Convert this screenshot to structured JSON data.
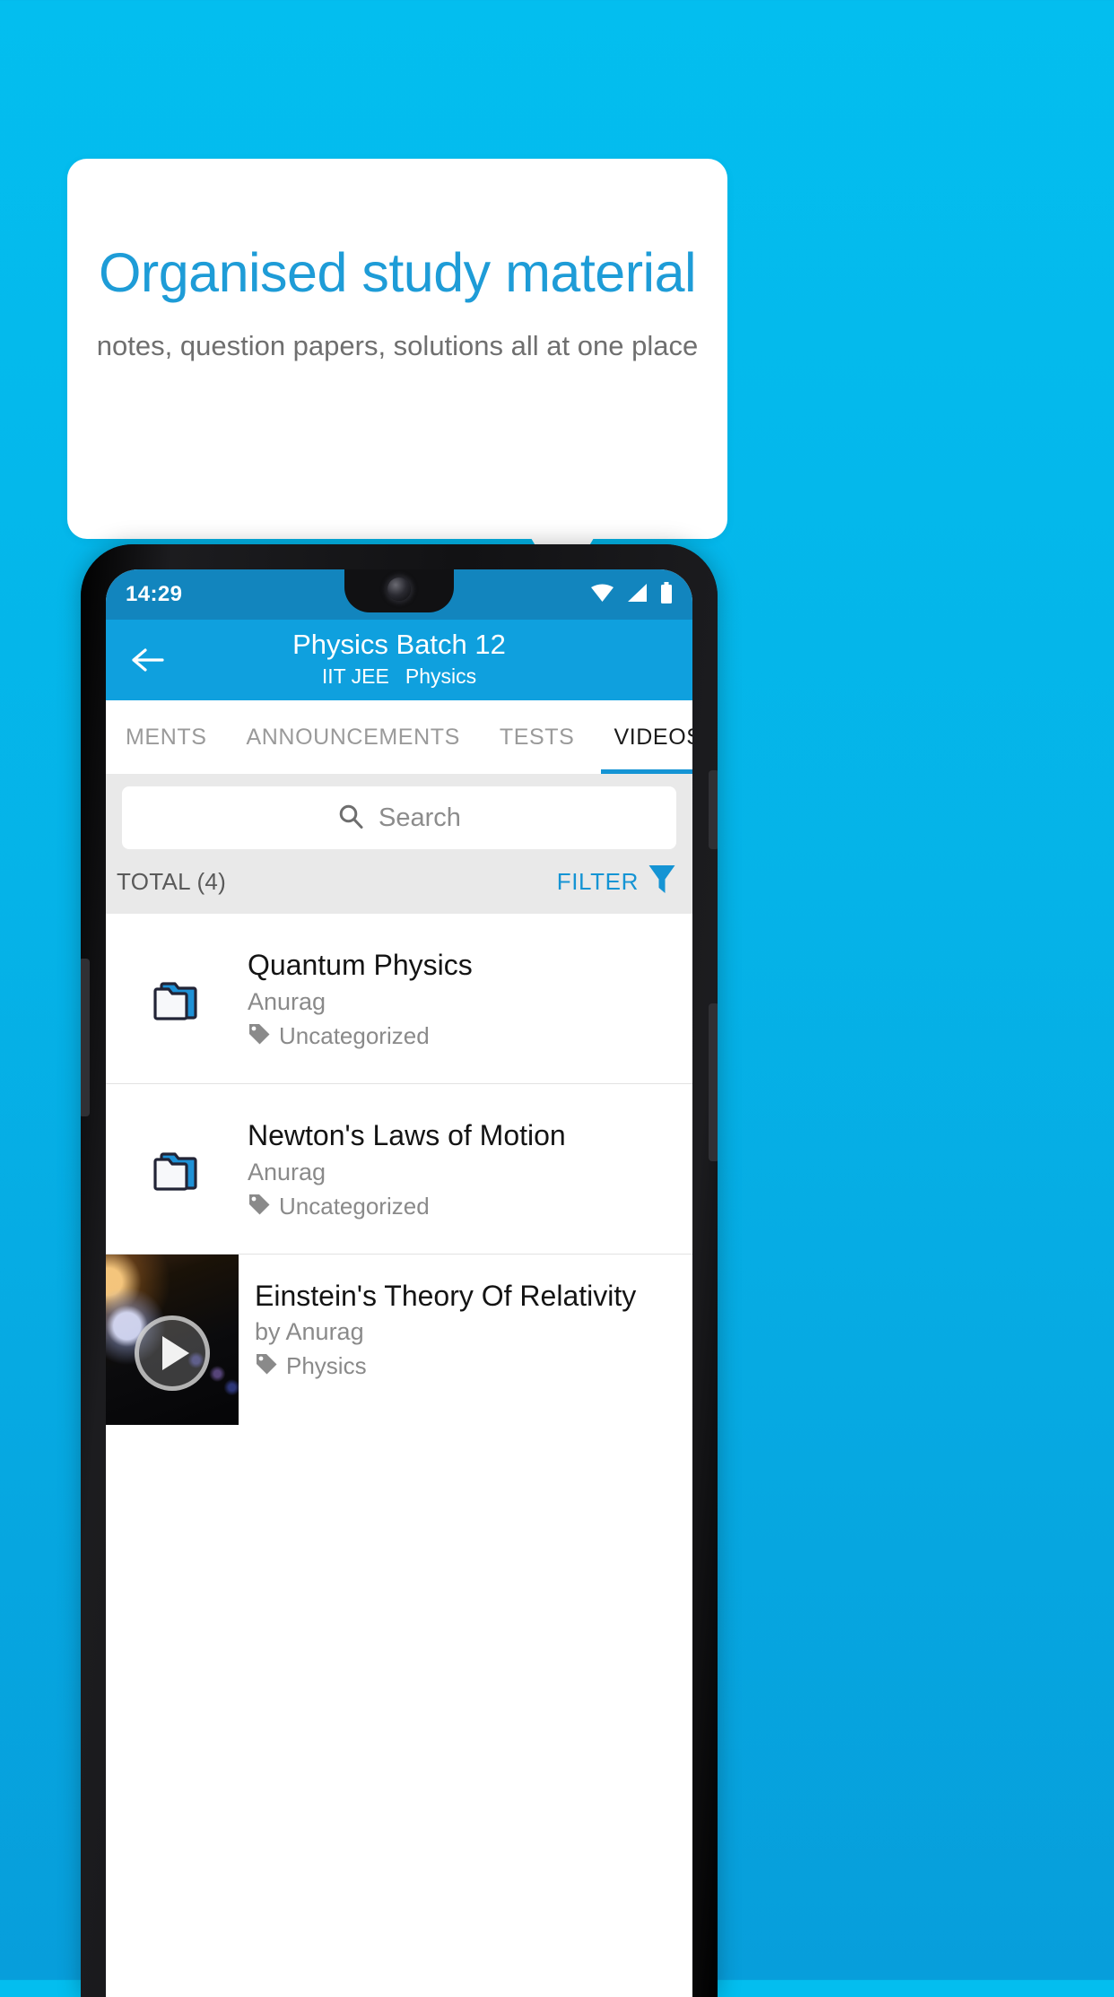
{
  "promo": {
    "headline": "Organised study material",
    "subheadline": "notes, question papers, solutions all at one place",
    "headline_color": "#1E9CD7",
    "background_color": "#03BEEF"
  },
  "phone": {
    "status_bar": {
      "time": "14:29",
      "icons": [
        "wifi-icon",
        "cellular-signal-icon",
        "battery-icon"
      ],
      "background_color": "#1285BE"
    },
    "app_bar": {
      "back_icon": "back-arrow-icon",
      "title": "Physics Batch 12",
      "subtitle_exam": "IIT JEE",
      "subtitle_subject": "Physics",
      "background_color": "#0FA0DE"
    },
    "tabs": [
      {
        "label": "MENTS",
        "active": false
      },
      {
        "label": "ANNOUNCEMENTS",
        "active": false
      },
      {
        "label": "TESTS",
        "active": false
      },
      {
        "label": "VIDEOS",
        "active": true
      }
    ],
    "search": {
      "placeholder": "Search",
      "icon": "search-icon"
    },
    "filter_row": {
      "total_label": "TOTAL (4)",
      "filter_label": "FILTER",
      "filter_icon": "funnel-icon",
      "accent_color": "#1594D4"
    },
    "list": [
      {
        "icon": "folder-icon",
        "title": "Quantum Physics",
        "author": "Anurag",
        "tag_icon": "tag-icon",
        "tag": "Uncategorized"
      },
      {
        "icon": "folder-icon",
        "title": "Newton's Laws of Motion",
        "author": "Anurag",
        "tag_icon": "tag-icon",
        "tag": "Uncategorized"
      },
      {
        "icon": "video-thumbnail",
        "play_icon": "play-icon",
        "title": "Einstein's Theory Of Relativity",
        "author": "by Anurag",
        "tag_icon": "tag-icon",
        "tag": "Physics"
      }
    ]
  }
}
